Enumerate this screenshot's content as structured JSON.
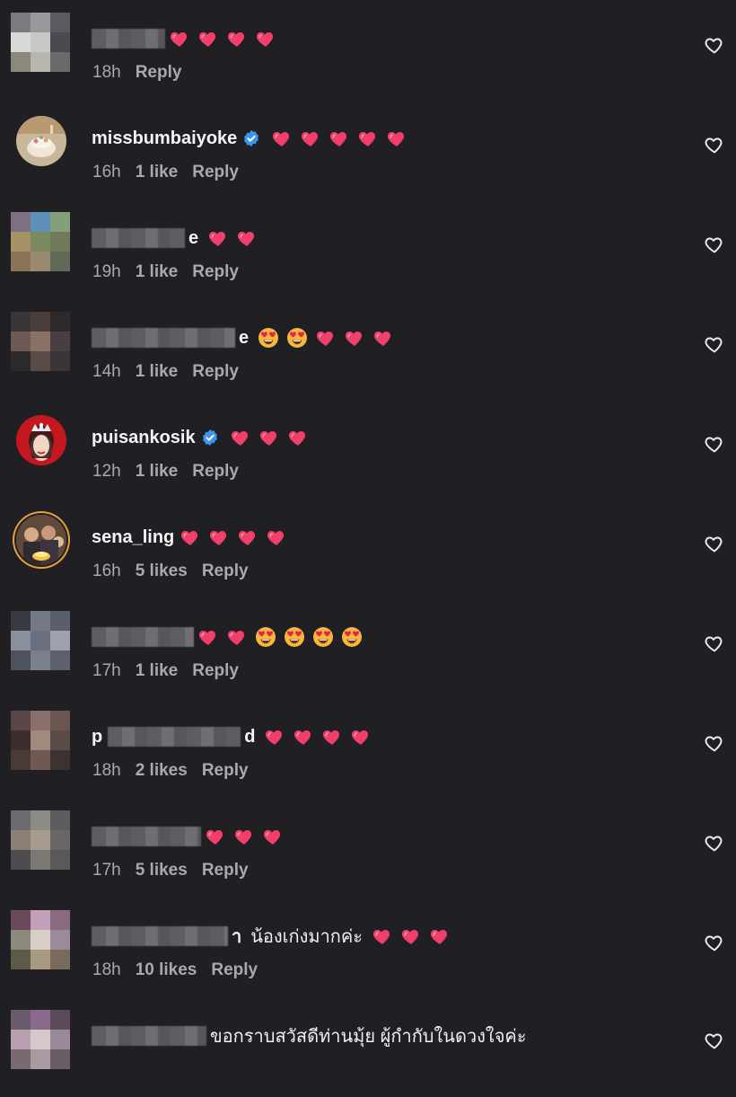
{
  "comments": [
    {
      "id": "c1",
      "username": "",
      "tail": "",
      "verified": false,
      "text": "",
      "emojis": [
        "heart",
        "heart",
        "heart",
        "heart"
      ],
      "time": "18h",
      "likes": "",
      "reply": "Reply",
      "avatar": "pixelated",
      "blur_w": 82
    },
    {
      "id": "c2",
      "username": "missbumbaiyoke",
      "tail": "",
      "verified": true,
      "text": "",
      "emojis": [
        "heart",
        "heart",
        "heart",
        "heart",
        "heart"
      ],
      "time": "16h",
      "likes": "1 like",
      "reply": "Reply",
      "avatar": "photo-cake"
    },
    {
      "id": "c3",
      "username": "",
      "tail": "e",
      "verified": false,
      "text": "",
      "emojis": [
        "heart",
        "heart"
      ],
      "time": "19h",
      "likes": "1 like",
      "reply": "Reply",
      "avatar": "pixelated",
      "blur_w": 104
    },
    {
      "id": "c4",
      "username": "",
      "tail": "e",
      "verified": false,
      "text": "",
      "emojis": [
        "heart-eyes",
        "heart-eyes",
        "heart",
        "heart",
        "heart"
      ],
      "time": "14h",
      "likes": "1 like",
      "reply": "Reply",
      "avatar": "pixelated",
      "blur_w": 160
    },
    {
      "id": "c5",
      "username": "puisankosik",
      "tail": "",
      "verified": true,
      "text": "",
      "emojis": [
        "heart",
        "heart",
        "heart"
      ],
      "time": "12h",
      "likes": "1 like",
      "reply": "Reply",
      "avatar": "photo-crown"
    },
    {
      "id": "c6",
      "username": "sena_ling",
      "tail": "",
      "verified": false,
      "text": "",
      "emojis": [
        "heart",
        "heart",
        "heart",
        "heart"
      ],
      "time": "16h",
      "likes": "5 likes",
      "reply": "Reply",
      "avatar": "photo-group"
    },
    {
      "id": "c7",
      "username": "",
      "tail": "",
      "verified": false,
      "text": "",
      "emojis": [
        "heart",
        "heart",
        "heart-eyes",
        "heart-eyes",
        "heart-eyes",
        "heart-eyes"
      ],
      "time": "17h",
      "likes": "1 like",
      "reply": "Reply",
      "avatar": "pixelated",
      "blur_w": 114
    },
    {
      "id": "c8",
      "username": "p",
      "tail": "d",
      "verified": false,
      "text": "",
      "emojis": [
        "heart",
        "heart",
        "heart",
        "heart"
      ],
      "time": "18h",
      "likes": "2 likes",
      "reply": "Reply",
      "avatar": "pixelated",
      "blur_w": 148
    },
    {
      "id": "c9",
      "username": "",
      "tail": "",
      "verified": false,
      "text": "",
      "emojis": [
        "heart",
        "heart",
        "heart"
      ],
      "time": "17h",
      "likes": "5 likes",
      "reply": "Reply",
      "avatar": "pixelated",
      "blur_w": 122
    },
    {
      "id": "c10",
      "username": "",
      "tail": "า",
      "verified": false,
      "text": "น้องเก่งมากค่ะ",
      "emojis": [
        "heart",
        "heart",
        "heart"
      ],
      "time": "18h",
      "likes": "10 likes",
      "reply": "Reply",
      "avatar": "pixelated",
      "blur_w": 152
    },
    {
      "id": "c11",
      "username": "",
      "tail": "",
      "verified": false,
      "text": "ขอกราบสวัสดีท่านมุ้ย ผู้กำกับในดวงใจค่ะ",
      "emojis": [],
      "time": "",
      "likes": "",
      "reply": "",
      "avatar": "pixelated",
      "blur_w": 128
    }
  ],
  "colors": {
    "background": "#1f1f24",
    "heart": "#f0406a",
    "meta": "#a9a9ae",
    "verified": "#3b96f0"
  },
  "icons": {
    "like": "heart-outline-icon",
    "verified": "verified-badge-icon"
  }
}
